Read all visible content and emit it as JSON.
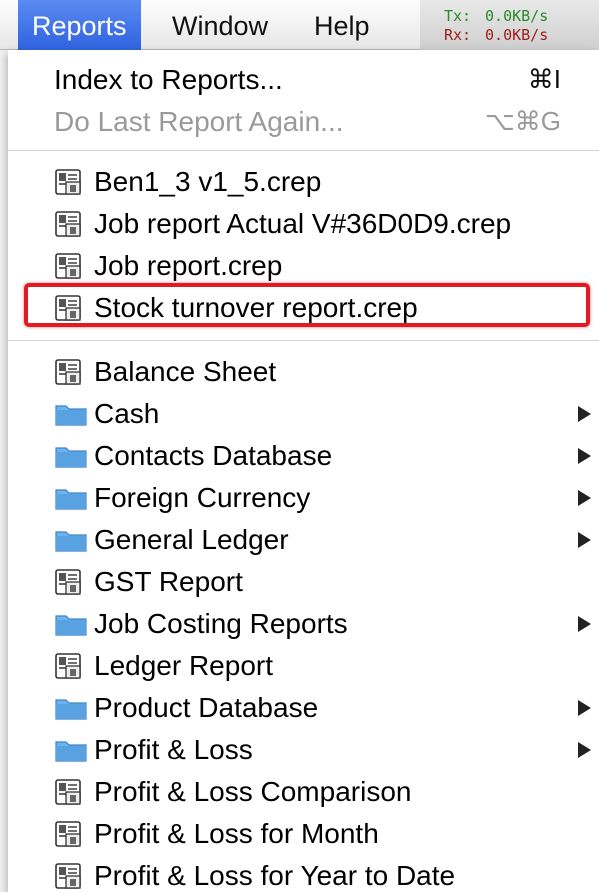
{
  "menubar": {
    "menus": [
      "Reports",
      "Window",
      "Help"
    ],
    "active_menu": "Reports",
    "network": {
      "tx_label": "Tx:",
      "tx_value": "0.0KB/s",
      "rx_label": "Rx:",
      "rx_value": "0.0KB/s"
    }
  },
  "reports_menu": {
    "index_label": "Index to Reports...",
    "index_shortcut": "⌘I",
    "repeat_label": "Do Last Report Again...",
    "repeat_shortcut": "⌥⌘G",
    "recent": [
      "Ben1_3 v1_5.crep",
      "Job report Actual V#36D0D9.crep",
      "Job report.crep",
      "Stock turnover report.crep"
    ],
    "reports": [
      "Balance Sheet",
      "Cash",
      "Contacts Database",
      "Foreign Currency",
      "General Ledger",
      "GST Report",
      "Job Costing Reports",
      "Ledger Report",
      "Product Database",
      "Profit & Loss",
      "Profit & Loss Comparison",
      "Profit & Loss for Month",
      "Profit & Loss for Year to Date"
    ]
  },
  "colors": {
    "selected_menu": "#3b6fe6",
    "highlight_box": "#e01b22",
    "folder": "#5aa6e6"
  }
}
